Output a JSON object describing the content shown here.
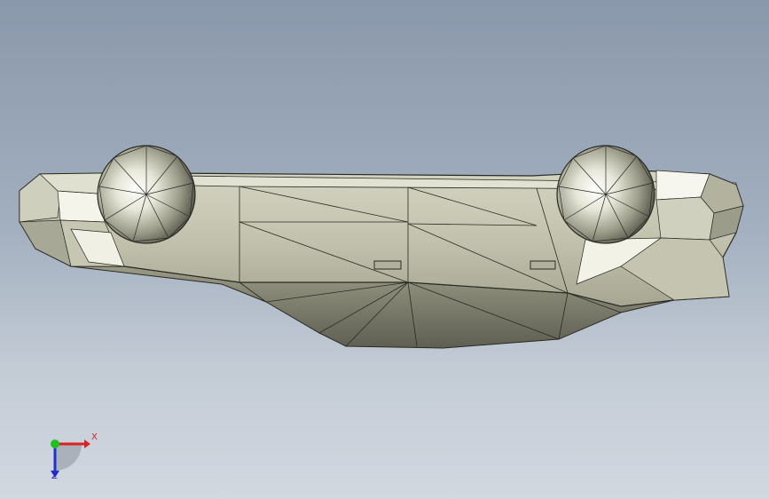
{
  "triad": {
    "x_label": "X",
    "z_label": "Z",
    "x_color": "#e02020",
    "y_color": "#20c020",
    "z_color": "#2030d0"
  },
  "model": {
    "fill_light": "#d8d8c6",
    "fill_mid": "#b8b8a4",
    "fill_dark": "#6e6e60",
    "edge_color": "#2a2a24"
  },
  "background": {
    "top_color": "#8a98ab",
    "bottom_color": "#d2d8e0"
  }
}
